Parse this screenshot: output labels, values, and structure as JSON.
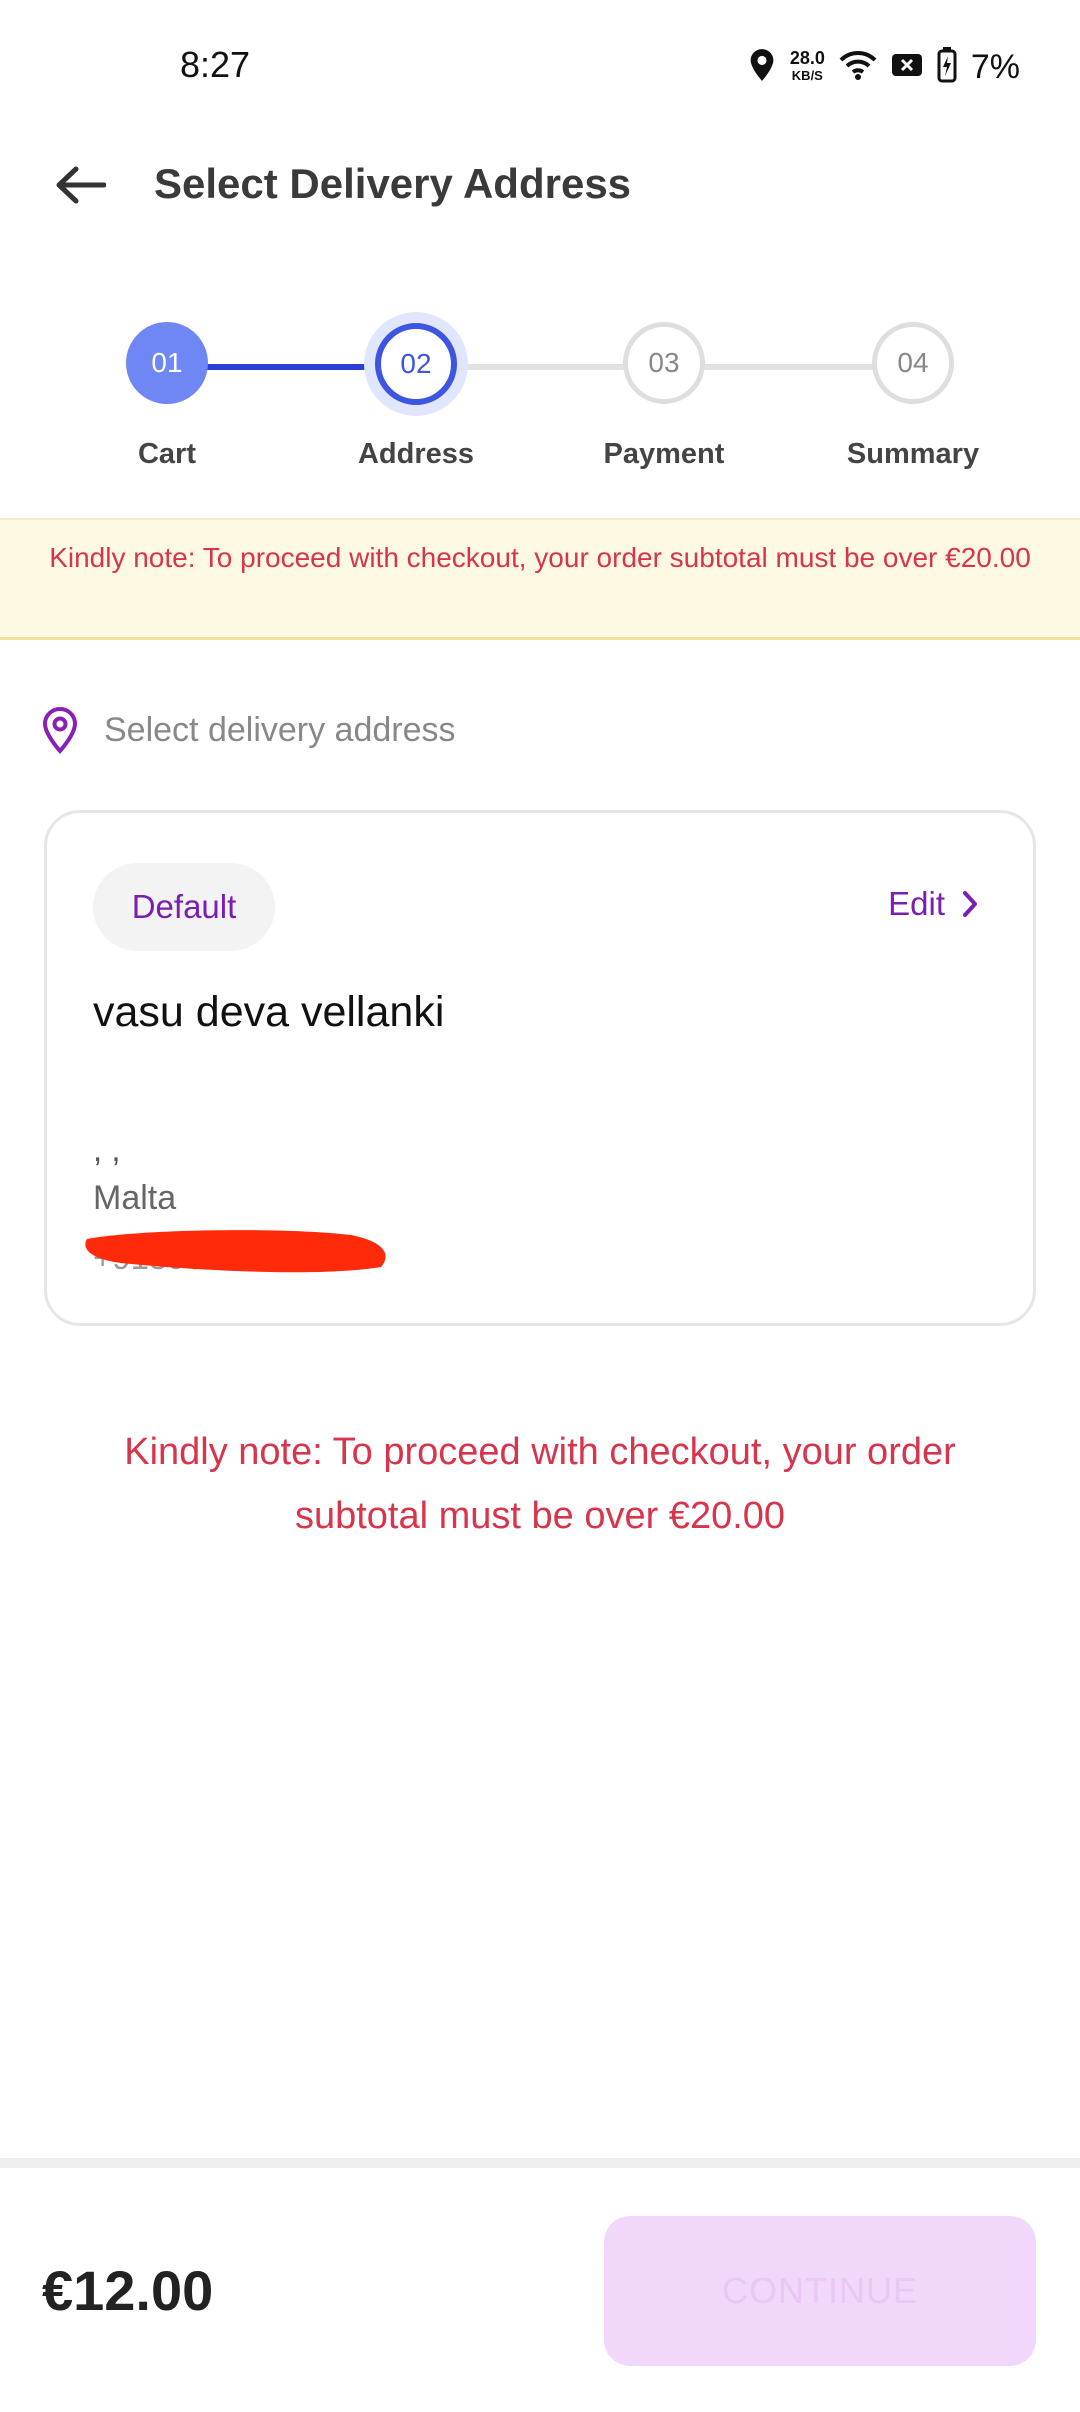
{
  "status_bar": {
    "time": "8:27",
    "speed_value": "28.0",
    "speed_unit": "KB/S",
    "battery": "7%"
  },
  "header": {
    "title": "Select Delivery Address"
  },
  "stepper": {
    "steps": [
      {
        "number": "01",
        "label": "Cart",
        "state": "completed"
      },
      {
        "number": "02",
        "label": "Address",
        "state": "active"
      },
      {
        "number": "03",
        "label": "Payment",
        "state": "pending"
      },
      {
        "number": "04",
        "label": "Summary",
        "state": "pending"
      }
    ]
  },
  "notice_banner": {
    "text": "Kindly note: To proceed with checkout, your order subtotal must be over €20.00"
  },
  "address_section": {
    "header": "Select delivery address",
    "card": {
      "badge": "Default",
      "edit_label": "Edit",
      "name": "vasu deva vellanki",
      "address_line": ", ,",
      "country": "Malta",
      "phone": "+91896"
    }
  },
  "notice_center": {
    "text": "Kindly note: To proceed with checkout, your order subtotal must be over €20.00"
  },
  "footer": {
    "total": "€12.00",
    "continue_label": "CONTINUE"
  },
  "colors": {
    "accent_blue": "#3d55e0",
    "step_done": "#6f86f5",
    "brand_purple": "#7a1fb0",
    "warning_red": "#d8344b"
  }
}
